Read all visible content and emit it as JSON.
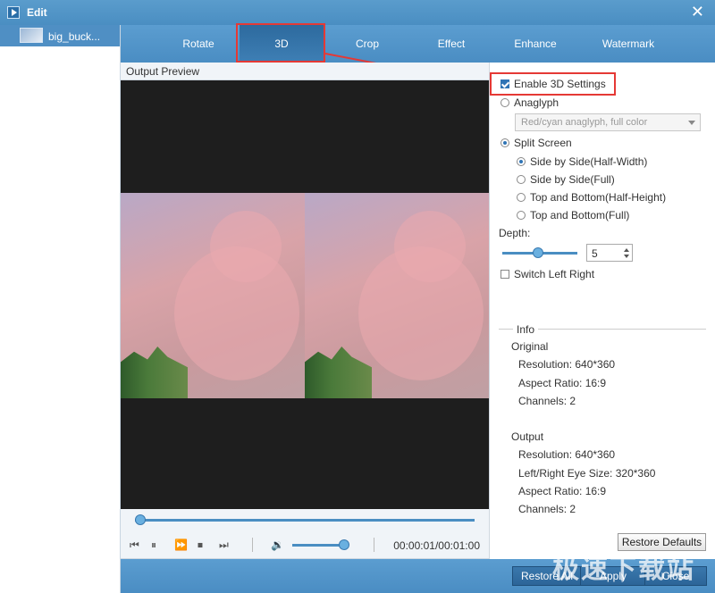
{
  "window": {
    "title": "Edit",
    "close_glyph": "✕"
  },
  "file_list": {
    "items": [
      {
        "name": "big_buck..."
      }
    ]
  },
  "tabs": [
    {
      "label": "Rotate"
    },
    {
      "label": "3D",
      "active": true
    },
    {
      "label": "Crop"
    },
    {
      "label": "Effect"
    },
    {
      "label": "Enhance"
    },
    {
      "label": "Watermark"
    }
  ],
  "preview": {
    "header": "Output Preview",
    "progress": 0.0,
    "volume": 0.8,
    "timecode": "00:00:01/00:01:00"
  },
  "settings": {
    "enable_3d_label": "Enable 3D Settings",
    "enable_3d_checked": true,
    "anaglyph_label": "Anaglyph",
    "anaglyph_option": "Red/cyan anaglyph, full color",
    "split_screen_label": "Split Screen",
    "split_options": [
      "Side by Side(Half-Width)",
      "Side by Side(Full)",
      "Top and Bottom(Half-Height)",
      "Top and Bottom(Full)"
    ],
    "depth_label": "Depth:",
    "depth_value": "5",
    "switch_label": "Switch Left Right",
    "info_title": "Info",
    "original_title": "Original",
    "original": {
      "resolution": "Resolution: 640*360",
      "aspect": "Aspect Ratio: 16:9",
      "channels": "Channels: 2"
    },
    "output_title": "Output",
    "output": {
      "resolution": "Resolution: 640*360",
      "eye_size": "Left/Right Eye Size: 320*360",
      "aspect": "Aspect Ratio: 16:9",
      "channels": "Channels: 2"
    },
    "restore_defaults": "Restore Defaults"
  },
  "bottom": {
    "restore_all": "Restore All",
    "apply": "Apply",
    "close": "Close"
  },
  "watermark_text": "极速下载站",
  "colors": {
    "accent": "#4a8ec2",
    "highlight": "#e53935"
  }
}
